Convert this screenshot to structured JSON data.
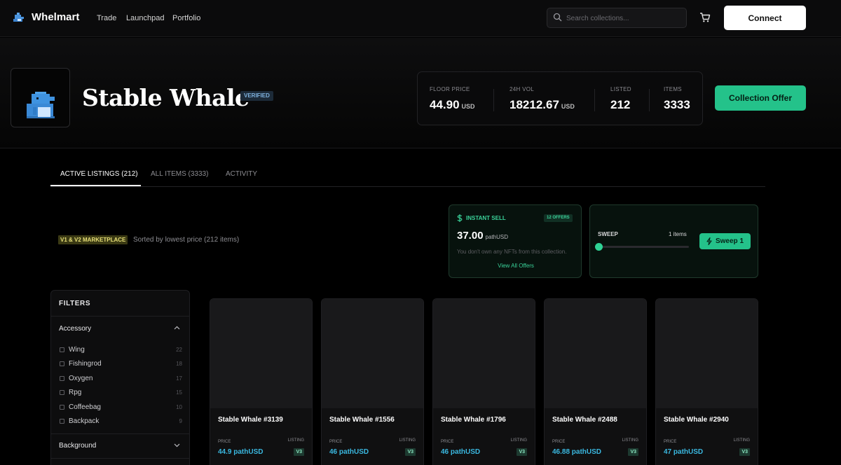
{
  "nav": {
    "brand": "Whelmart",
    "links": [
      "Trade",
      "Launchpad",
      "Portfolio"
    ],
    "search_placeholder": "Search collections...",
    "connect_label": "Connect"
  },
  "collection": {
    "name": "Stable Whale",
    "verified_label": "VERIFIED",
    "stats": [
      {
        "label": "FLOOR PRICE",
        "value": "44.90",
        "unit": "USD"
      },
      {
        "label": "24H VOL",
        "value": "18212.67",
        "unit": "USD"
      },
      {
        "label": "LISTED",
        "value": "212",
        "unit": ""
      },
      {
        "label": "ITEMS",
        "value": "3333",
        "unit": ""
      }
    ],
    "offer_button": "Collection Offer"
  },
  "tabs": [
    "ACTIVE LISTINGS (212)",
    "ALL ITEMS (3333)",
    "ACTIVITY"
  ],
  "marketplace": {
    "badge": "V1 & V2 MARKETPLACE",
    "sort_text": "Sorted by lowest price (212 items)"
  },
  "instant_sell": {
    "title": "INSTANT SELL",
    "offers_badge": "12 OFFERS",
    "price": "37.00",
    "unit": "pathUSD",
    "note": "You don't own any NFTs from this collection.",
    "link": "View All Offers"
  },
  "sweep": {
    "label": "SWEEP",
    "count": "1 items",
    "level": 0,
    "button": "Sweep 1"
  },
  "filters": {
    "title": "FILTERS",
    "groups": [
      {
        "name": "Accessory",
        "expanded": true,
        "items": [
          {
            "label": "Wing",
            "count": "22"
          },
          {
            "label": "Fishingrod",
            "count": "18"
          },
          {
            "label": "Oxygen",
            "count": "17"
          },
          {
            "label": "Rpg",
            "count": "15"
          },
          {
            "label": "Coffeebag",
            "count": "10"
          },
          {
            "label": "Backpack",
            "count": "9"
          }
        ]
      },
      {
        "name": "Background",
        "expanded": false
      }
    ]
  },
  "listing_labels": {
    "price": "PRICE",
    "listing": "LISTING"
  },
  "listings": [
    {
      "name": "Stable Whale #3139",
      "price": "44.9 pathUSD",
      "version": "V3"
    },
    {
      "name": "Stable Whale #1556",
      "price": "46 pathUSD",
      "version": "V3"
    },
    {
      "name": "Stable Whale #1796",
      "price": "46 pathUSD",
      "version": "V3"
    },
    {
      "name": "Stable Whale #2488",
      "price": "46.88 pathUSD",
      "version": "V3"
    },
    {
      "name": "Stable Whale #2940",
      "price": "47 pathUSD",
      "version": "V3"
    }
  ],
  "colors": {
    "accent": "#24c28a",
    "price": "#3ab8e0",
    "background": "#000000"
  }
}
